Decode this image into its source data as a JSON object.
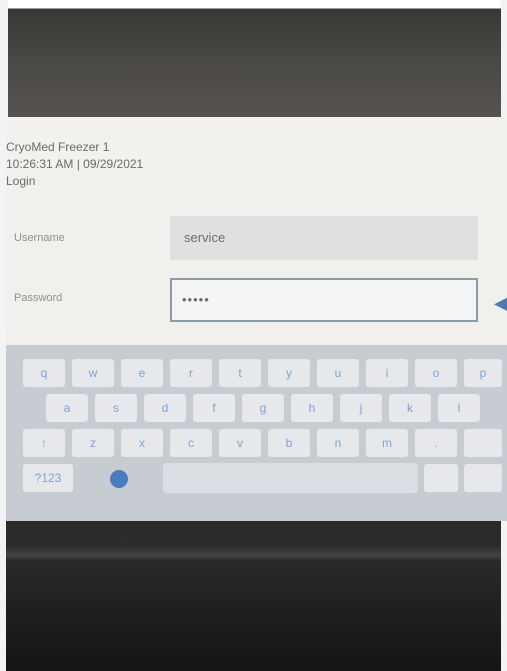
{
  "header": {
    "title": "CryoMed Freezer 1",
    "datetime": "10:26:31 AM | 09/29/2021",
    "screen_name": "Login"
  },
  "form": {
    "username_label": "Username",
    "username_value": "service",
    "password_label": "Password",
    "password_value": "•••••"
  },
  "keyboard": {
    "row1": [
      "q",
      "w",
      "e",
      "r",
      "t",
      "y",
      "u",
      "i",
      "o",
      "p"
    ],
    "row2": [
      "a",
      "s",
      "d",
      "f",
      "g",
      "h",
      "j",
      "k",
      "l"
    ],
    "row3": [
      "↑",
      "z",
      "x",
      "c",
      "v",
      "b",
      "n",
      "m",
      ".",
      ""
    ],
    "row4": {
      "mode_key": "?123",
      "globe_icon": "globe-icon",
      "right_keys": [
        "",
        ""
      ]
    }
  },
  "colors": {
    "screen_bg": "#f0efec",
    "keyboard_bg": "#c7ccd2",
    "key_text": "#7da3cf",
    "accent": "#4a7cc0"
  }
}
